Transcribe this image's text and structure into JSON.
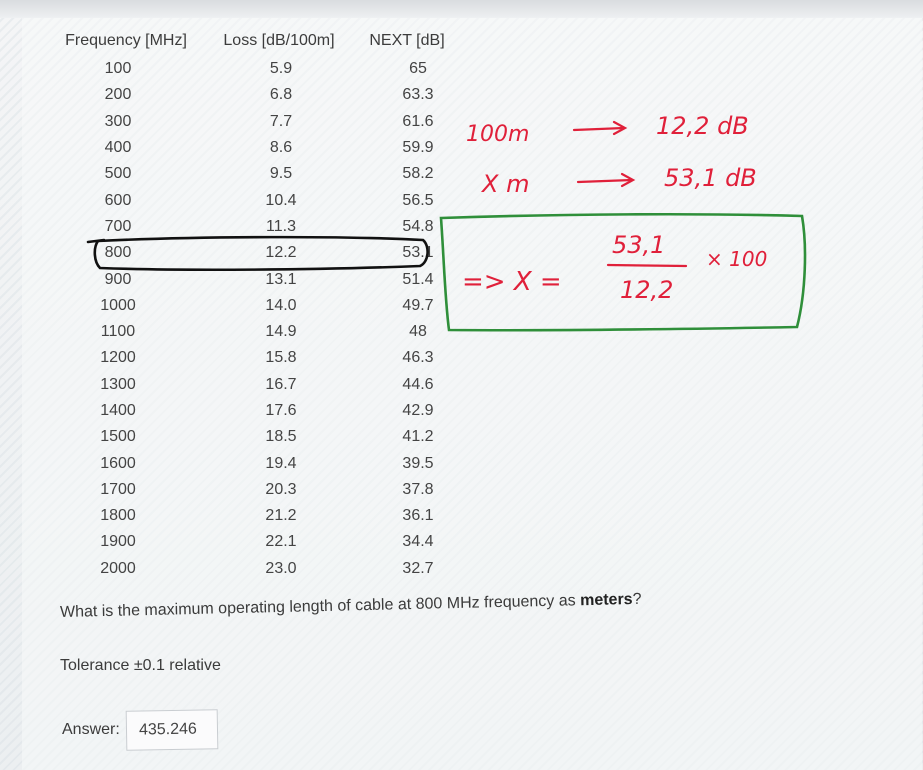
{
  "table": {
    "headers": [
      "Frequency [MHz]",
      "Loss [dB/100m]",
      "NEXT [dB]"
    ],
    "rows": [
      [
        "100",
        "5.9",
        "65"
      ],
      [
        "200",
        "6.8",
        "63.3"
      ],
      [
        "300",
        "7.7",
        "61.6"
      ],
      [
        "400",
        "8.6",
        "59.9"
      ],
      [
        "500",
        "9.5",
        "58.2"
      ],
      [
        "600",
        "10.4",
        "56.5"
      ],
      [
        "700",
        "11.3",
        "54.8"
      ],
      [
        "800",
        "12.2",
        "53.1"
      ],
      [
        "900",
        "13.1",
        "51.4"
      ],
      [
        "1000",
        "14.0",
        "49.7"
      ],
      [
        "1100",
        "14.9",
        "48"
      ],
      [
        "1200",
        "15.8",
        "46.3"
      ],
      [
        "1300",
        "16.7",
        "44.6"
      ],
      [
        "1400",
        "17.6",
        "42.9"
      ],
      [
        "1500",
        "18.5",
        "41.2"
      ],
      [
        "1600",
        "19.4",
        "39.5"
      ],
      [
        "1700",
        "20.3",
        "37.8"
      ],
      [
        "1800",
        "21.2",
        "36.1"
      ],
      [
        "1900",
        "22.1",
        "34.4"
      ],
      [
        "2000",
        "23.0",
        "32.7"
      ]
    ],
    "highlighted_row": "800"
  },
  "annotations": {
    "line1_left": "100m",
    "line1_right": "12,2 dB",
    "line2_left": "X m",
    "line2_right": "53,1 dB",
    "formula_prefix": "=> X =",
    "formula_numerator": "53,1",
    "formula_denominator": "12,2",
    "formula_multiplier": "× 100",
    "ink_red": "#e0203a",
    "ink_green": "#2f8f3a",
    "ink_black": "#111111"
  },
  "question": {
    "text_before": "What is the maximum operating length of cable at 800 MHz frequency as ",
    "text_bold": "meters",
    "text_after": "?",
    "tolerance": "Tolerance ±0.1 relative"
  },
  "answer": {
    "label": "Answer:",
    "value": "435.246"
  }
}
